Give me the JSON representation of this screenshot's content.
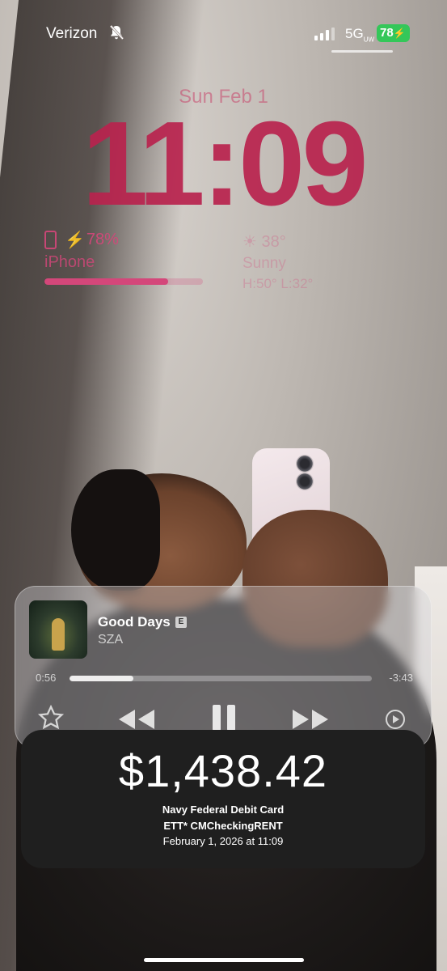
{
  "status_bar": {
    "carrier": "Verizon",
    "network": "5G",
    "network_suffix": "UW",
    "battery_level": "78"
  },
  "lock_screen": {
    "date": "Sun Feb 1",
    "time": "11:09"
  },
  "widgets": {
    "battery": {
      "percent_text": "78%",
      "device": "iPhone",
      "level": 0.78
    },
    "weather": {
      "temp": "38°",
      "condition": "Sunny",
      "range": "H:50° L:32°"
    }
  },
  "now_playing": {
    "title": "Good Days",
    "explicit": "E",
    "artist": "SZA",
    "elapsed": "0:56",
    "remaining": "-3:43",
    "progress": 0.21
  },
  "notification": {
    "amount": "$1,438.42",
    "card": "Navy Federal Debit Card",
    "merchant": "ETT* CMCheckingRENT",
    "timestamp": "February 1, 2026 at 11:09"
  },
  "colors": {
    "clock": "#b9234e",
    "widget": "#d4477a",
    "battery_badge": "#34c759"
  }
}
